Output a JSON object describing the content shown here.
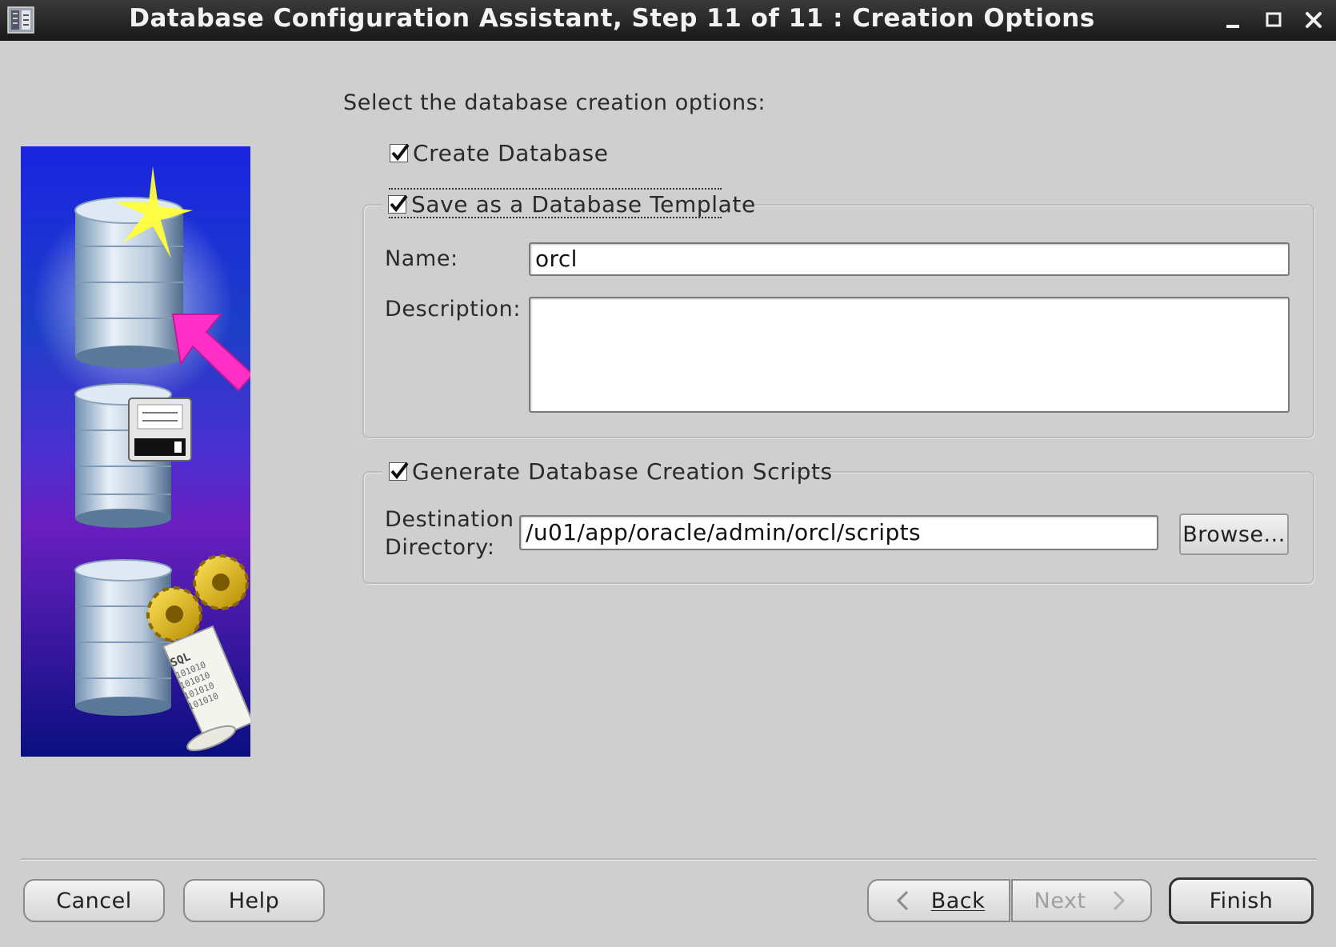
{
  "window": {
    "title": "Database Configuration Assistant, Step 11 of 11 : Creation Options",
    "app_icon": "database-app-icon",
    "controls": [
      "minimize-icon",
      "maximize-icon",
      "close-icon"
    ]
  },
  "main": {
    "prompt": "Select the database creation options:",
    "create_database": {
      "label": "Create Database",
      "checked": true
    },
    "save_template": {
      "label": "Save as a Database Template",
      "checked": true,
      "name_label": "Name:",
      "name_value": "orcl",
      "description_label": "Description:",
      "description_value": ""
    },
    "generate_scripts": {
      "label": "Generate Database Creation Scripts",
      "checked": true,
      "destination_label_line1": "Destination",
      "destination_label_line2": "Directory:",
      "destination_value": "/u01/app/oracle/admin/orcl/scripts",
      "browse_label": "Browse..."
    }
  },
  "footer": {
    "cancel_label": "Cancel",
    "help_label": "Help",
    "back_label": "Back",
    "next_label": "Next",
    "next_enabled": false,
    "finish_label": "Finish"
  }
}
